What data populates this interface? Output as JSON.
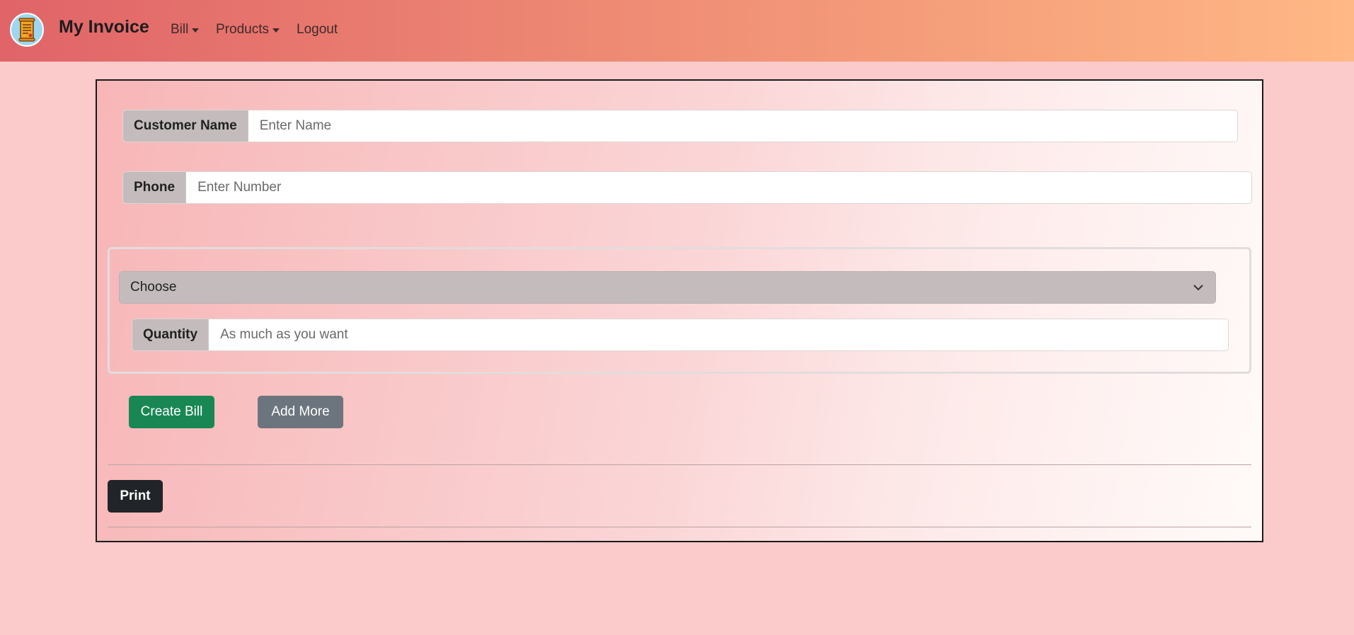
{
  "nav": {
    "brand": "My Invoice",
    "items": [
      {
        "label": "Bill",
        "dropdown": true
      },
      {
        "label": "Products",
        "dropdown": true
      },
      {
        "label": "Logout",
        "dropdown": false
      }
    ]
  },
  "form": {
    "customer_name": {
      "label": "Customer Name",
      "placeholder": "Enter Name",
      "value": ""
    },
    "phone": {
      "label": "Phone",
      "placeholder": "Enter Number",
      "value": ""
    },
    "product_select": {
      "selected": "Choose"
    },
    "quantity": {
      "label": "Quantity",
      "placeholder": "As much as you want",
      "value": ""
    }
  },
  "buttons": {
    "create_bill": "Create Bill",
    "add_more": "Add More",
    "print": "Print"
  },
  "colors": {
    "create_bill": "#198754",
    "add_more": "#6c757d",
    "print": "#212529",
    "input_label_bg": "#c4bcbc"
  },
  "icons": {
    "logo": "scroll-invoice-icon",
    "dropdown": "chevron-down-icon"
  }
}
